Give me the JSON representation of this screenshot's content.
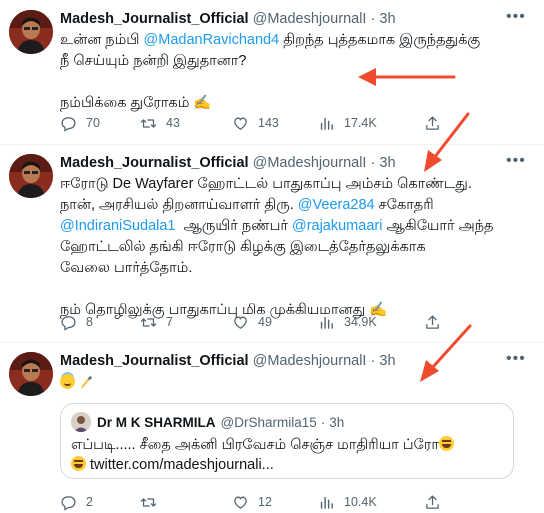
{
  "colors": {
    "accent": "#1d9bf0",
    "arrow": "#ef4b2f",
    "muted": "#536471"
  },
  "icons": {
    "reply": "reply-icon",
    "retweet": "retweet-icon",
    "like": "heart-icon",
    "views": "views-icon",
    "share": "share-icon",
    "more": "more-icon"
  },
  "tweets": [
    {
      "name": "Madesh_Journalist_Official",
      "handle": "@MadeshjournalI",
      "dot": "·",
      "time": "3h",
      "line1_pre": "உன்ன நம்பி ",
      "line1_mention": "@MadanRavichand4",
      "line1_post": " திறந்த புத்தகமாக இருந்ததுக்கு",
      "line2": "நீ செய்யும் நன்றி இதுதானா?",
      "line3": "நம்பிக்கை துரோகம் ✍️",
      "replies": "70",
      "retweets": "43",
      "likes": "143",
      "views": "17.4K"
    },
    {
      "name": "Madesh_Journalist_Official",
      "handle": "@MadeshjournalI",
      "dot": "·",
      "time": "3h",
      "line1": "ஈரோடு De Wayfarer ஹோட்டல் பாதுகாப்பு அம்சம் கொண்டது.",
      "line2_pre": "நான், அரசியல் திறனாய்வாளர் திரு. ",
      "line2_mention": "@Veera284",
      "line2_post": " சகோதரி",
      "line3_mention1": "@IndiraniSudala1",
      "line3_mid": "  ஆருயிர் நண்பர் ",
      "line3_mention2": "@rajakumaari",
      "line3_post": " ஆகியோர் அந்த",
      "line4": "ஹோட்டலில் தங்கி ஈரோடு கிழக்கு இடைத்தேர்தலுக்காக",
      "line5": "வேலை பார்த்தோம்.",
      "line6": "நம் தொழிலுக்கு பாதுகாப்பு மிக முக்கியமானது ✍️",
      "replies": "8",
      "retweets": "7",
      "likes": "49",
      "views": "34.9K"
    },
    {
      "name": "Madesh_Journalist_Official",
      "handle": "@MadeshjournalI",
      "dot": "·",
      "time": "3h",
      "quote": {
        "name": "Dr M K SHARMILA",
        "handle": "@DrSharmila15",
        "dot": "·",
        "time": "3h",
        "line1": "எப்படி..... சீதை அக்னி பிரவேசம் செஞ்ச மாதிரியா ப்ரோ",
        "line2": " twitter.com/madeshjournali..."
      },
      "replies": "2",
      "retweets": "",
      "likes": "12",
      "views": "10.4K"
    }
  ]
}
